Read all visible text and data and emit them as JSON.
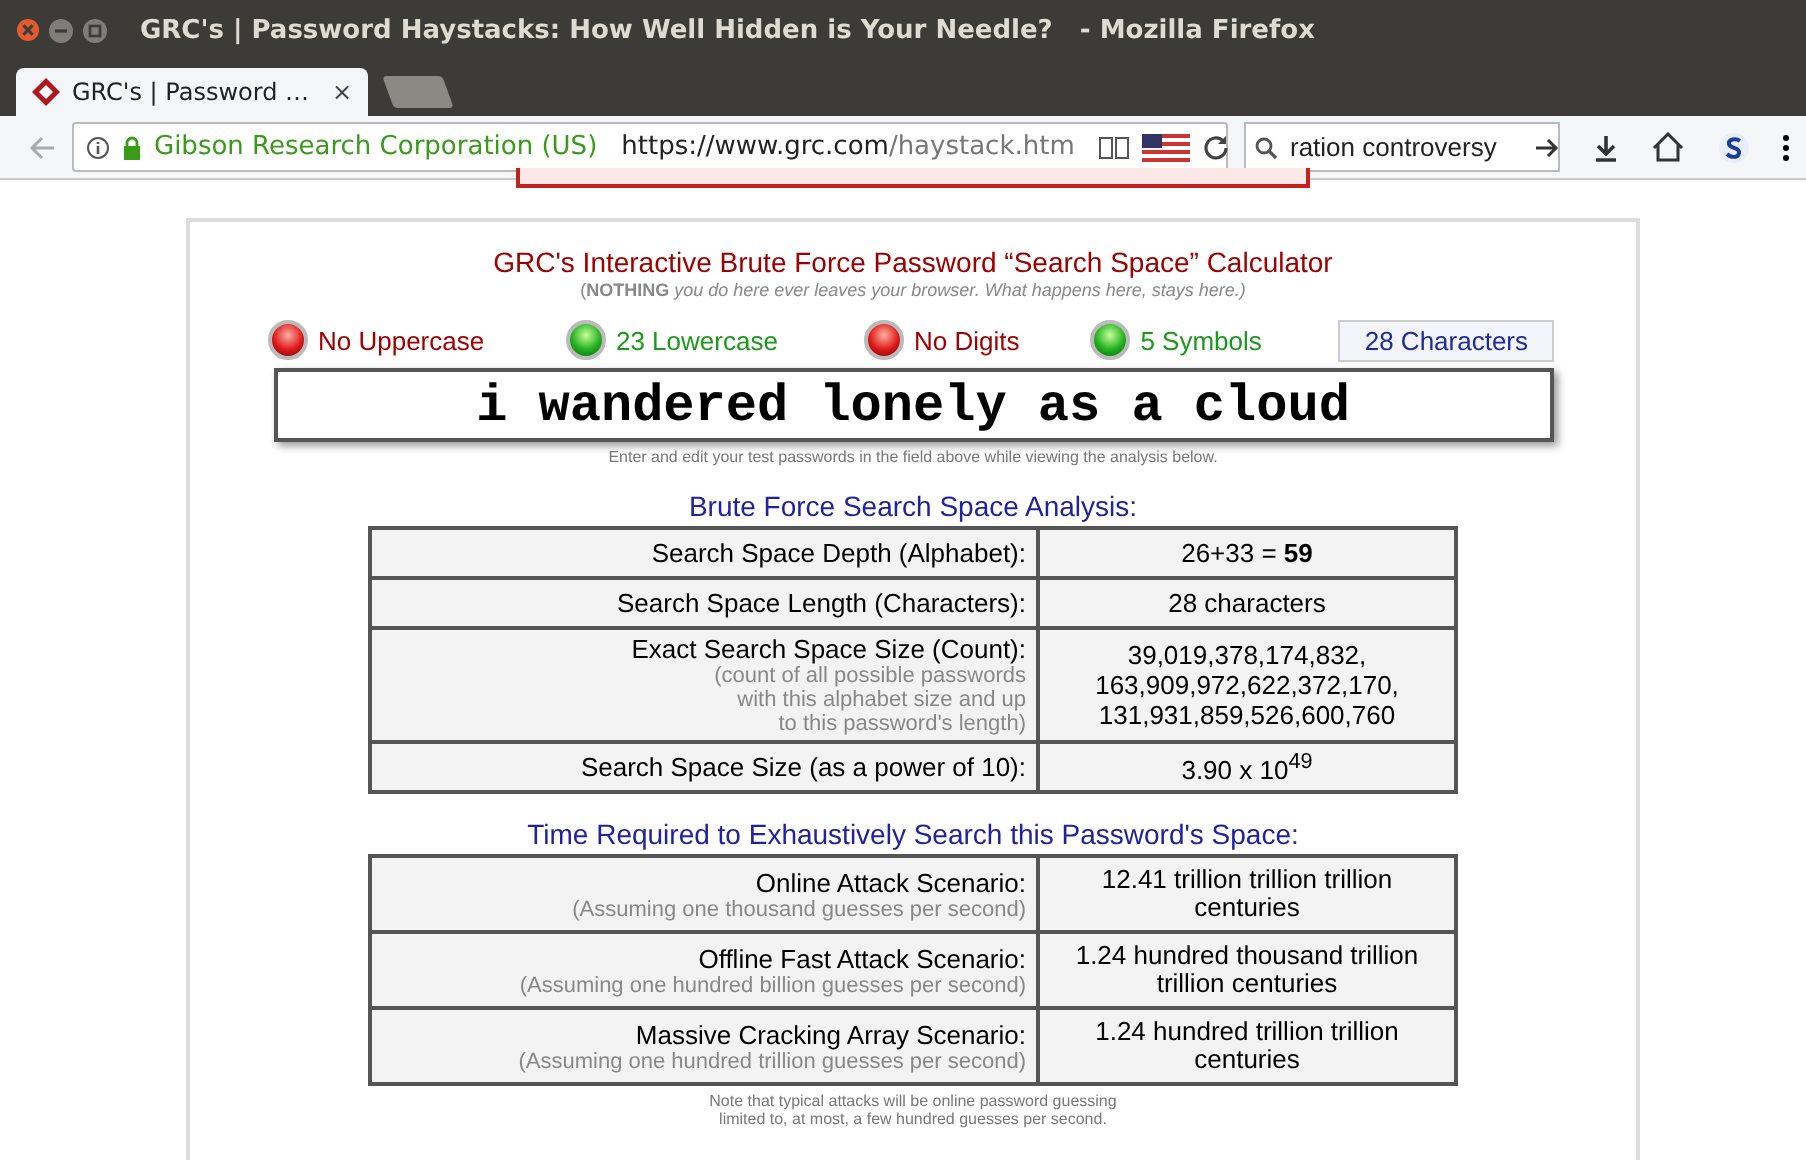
{
  "window": {
    "title": "GRC's | Password Haystacks: How Well Hidden is Your Needle?   - Mozilla Firefox"
  },
  "tabs": [
    {
      "label": "GRC's | Password …",
      "close": "×",
      "selected": true
    },
    {
      "selected": false
    }
  ],
  "navbar": {
    "identity": "Gibson Research Corporation (US)",
    "url_host": "https://www.grc.com",
    "url_path": "/haystack.htm",
    "search_value": "ration controversy"
  },
  "calculator": {
    "title": "GRC's Interactive Brute Force Password “Search Space” Calculator",
    "subtitle": "(**NOTHING** *you do here ever leaves your browser. What happens here, stays here.)*",
    "indicators": [
      {
        "label": "No Uppercase",
        "on": false
      },
      {
        "label": "23 Lowercase",
        "on": true
      },
      {
        "label": "No Digits",
        "on": false
      },
      {
        "label": "5 Symbols",
        "on": true
      }
    ],
    "character_count": "28 Characters",
    "password": "i wandered lonely as a cloud",
    "hint": "Enter and edit your test passwords in the field above while viewing the analysis below.",
    "analysis_heading": "Brute Force Search Space Analysis:",
    "analysis_rows": [
      {
        "label": "Search Space Depth (Alphabet):",
        "value": [
          "26+33 = **59**"
        ]
      },
      {
        "label": "Search Space Length (Characters):",
        "value": [
          "28 characters"
        ]
      },
      {
        "label": "Exact Search Space Size (Count):",
        "note": [
          "(count of all possible passwords",
          "with this alphabet size and up",
          "to this password's length)"
        ],
        "value": [
          "39,019,378,174,832,",
          "163,909,972,622,372,170,",
          "131,931,859,526,600,760"
        ]
      },
      {
        "label": "Search Space Size (as a power of 10):",
        "value": [
          "3.90 x 10$^{49}$"
        ]
      }
    ],
    "time_heading": "Time Required to Exhaustively Search this Password's Space:",
    "time_rows": [
      {
        "label": "Online Attack Scenario:",
        "note": [
          "(Assuming one thousand guesses per second)"
        ],
        "value": [
          "12.41 trillion trillion trillion",
          "centuries"
        ]
      },
      {
        "label": "Offline Fast Attack Scenario:",
        "note": [
          "(Assuming one hundred billion guesses per second)"
        ],
        "value": [
          "1.24 hundred thousand trillion",
          "trillion centuries"
        ]
      },
      {
        "label": "Massive Cracking Array Scenario:",
        "note": [
          "(Assuming one hundred trillion guesses per second)"
        ],
        "value": [
          "1.24 hundred trillion trillion",
          "centuries"
        ]
      }
    ],
    "footnote": [
      "Note that typical attacks will be online password guessing",
      "limited to, at most, a few hundred guesses per second."
    ]
  }
}
